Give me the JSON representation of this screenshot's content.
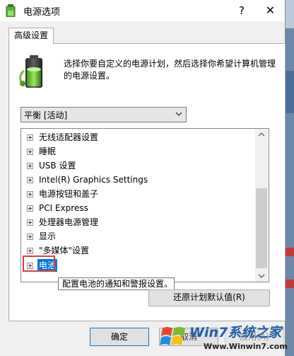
{
  "window": {
    "title": "电源选项",
    "help_glyph": "?",
    "close_glyph": "✕"
  },
  "tabs": [
    {
      "label": "高级设置"
    }
  ],
  "description": "选择你要自定义的电源计划，然后选择你希望计算机管理的电源设置。",
  "plan_select": {
    "value": "平衡 [活动]"
  },
  "settings_tree": [
    {
      "label": "无线适配器设置"
    },
    {
      "label": "睡眠"
    },
    {
      "label": "USB 设置"
    },
    {
      "label": "Intel(R) Graphics Settings"
    },
    {
      "label": "电源按钮和盖子"
    },
    {
      "label": "PCI Express"
    },
    {
      "label": "处理器电源管理"
    },
    {
      "label": "显示"
    },
    {
      "label": "\"多媒体\"设置"
    },
    {
      "label": "电池",
      "selected": true
    }
  ],
  "tooltip": "配置电池的通知和警报设置。",
  "buttons": {
    "restore": "还原计划默认值(R)",
    "ok": "确定",
    "cancel": "取消",
    "apply": "应用(A)"
  },
  "watermark": {
    "main": "Win7系统之家",
    "url": "Www.Winwin7.com"
  },
  "colors": {
    "accent": "#0078d7",
    "highlight": "#e53a3a"
  }
}
